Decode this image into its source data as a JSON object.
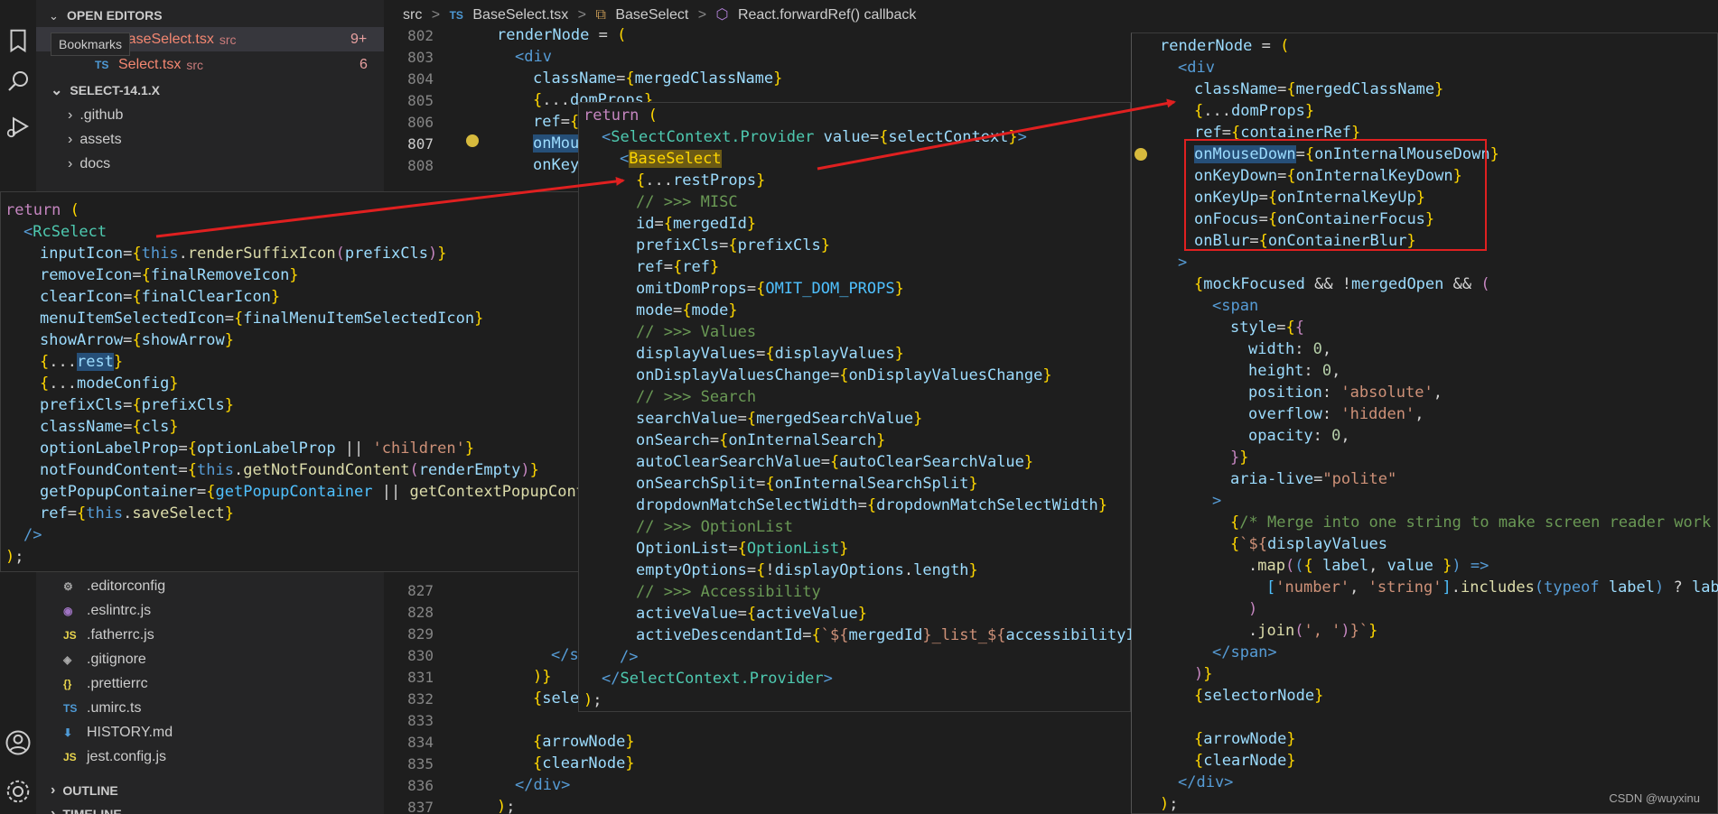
{
  "sidebar": {
    "open_editors_label": "OPEN EDITORS",
    "tooltip": "Bookmarks",
    "open_files": [
      {
        "type": "TS",
        "name": "BaseSelect.tsx",
        "dir": "src",
        "badge": "9+"
      },
      {
        "type": "TS",
        "name": "Select.tsx",
        "dir": "src",
        "badge": "6"
      }
    ],
    "workspace_label": "SELECT-14.1.X",
    "folders": [
      ".github",
      "assets",
      "docs"
    ],
    "files": [
      {
        "icon": "⚙",
        "name": ".editorconfig"
      },
      {
        "icon": "◉",
        "name": ".eslintrc.js"
      },
      {
        "icon": "JS",
        "name": ".fatherrc.js"
      },
      {
        "icon": "◈",
        "name": ".gitignore"
      },
      {
        "icon": "{}",
        "name": ".prettierrc"
      },
      {
        "icon": "TS",
        "name": ".umirc.ts"
      },
      {
        "icon": "⬇",
        "name": "HISTORY.md"
      },
      {
        "icon": "JS",
        "name": "jest.config.js"
      }
    ],
    "outline_label": "OUTLINE",
    "timeline_label": "TIMELINE"
  },
  "breadcrumb": [
    "src",
    ">",
    "TS",
    "BaseSelect.tsx",
    ">",
    "BaseSelect",
    ">",
    "React.forwardRef() callback"
  ],
  "watermark": "CSDN @wuyxinu",
  "colors": {
    "arrow": "#e02020",
    "box": "#e02020"
  }
}
